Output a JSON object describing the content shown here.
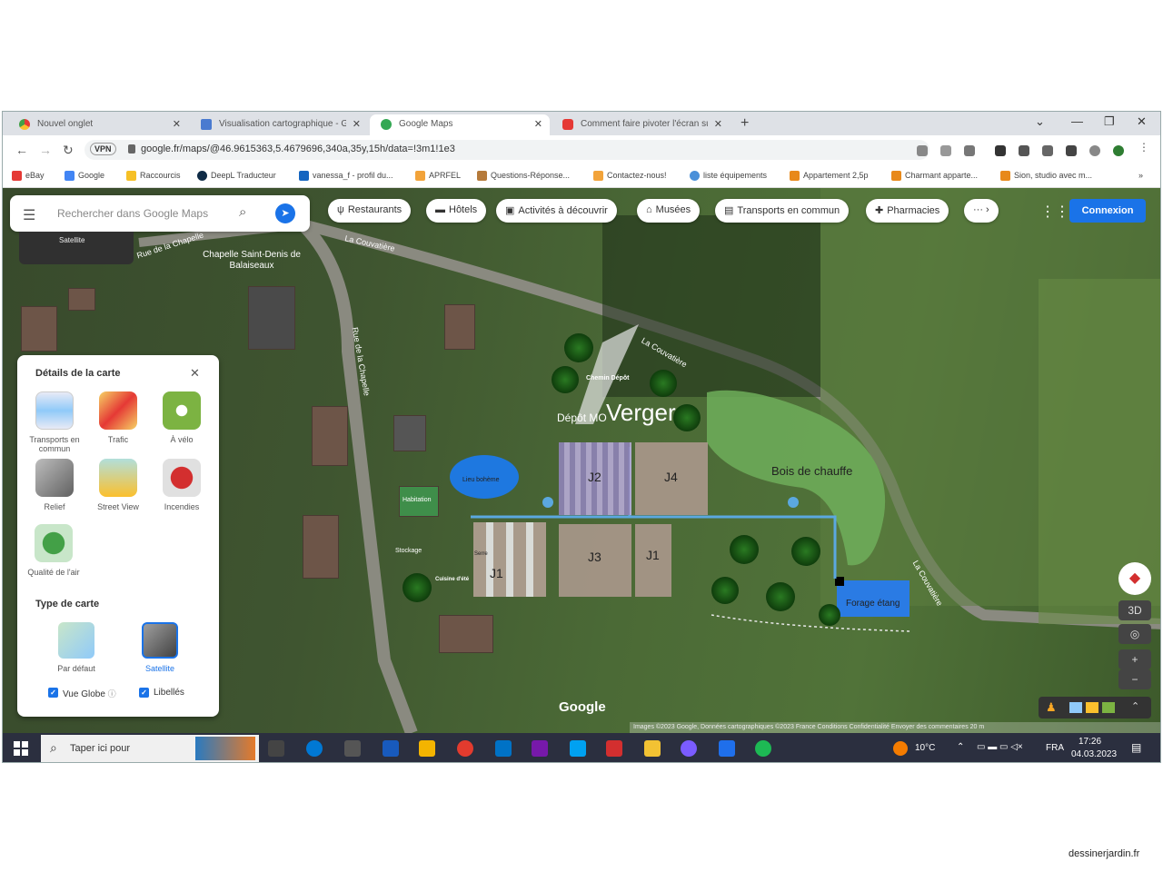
{
  "browser": {
    "tabs": [
      {
        "title": "Nouvel onglet",
        "color": "#f2a33a"
      },
      {
        "title": "Visualisation cartographique - G",
        "color": "#4a7bd0"
      },
      {
        "title": "Google Maps",
        "color": "#34a853"
      },
      {
        "title": "Comment faire pivoter l'écran su",
        "color": "#e53935"
      }
    ],
    "url": "google.fr/maps/@46.9615363,5.4679696,340a,35y,15h/data=!3m1!1e3",
    "vpn_label": "VPN",
    "bookmarks": [
      {
        "label": "eBay",
        "color": "#e53935"
      },
      {
        "label": "Google",
        "color": "#4285f4"
      },
      {
        "label": "Raccourcis",
        "color": "#f6c026"
      },
      {
        "label": "DeepL Traducteur",
        "color": "#0f2b46"
      },
      {
        "label": "vanessa_f - profil du...",
        "color": "#1565c0"
      },
      {
        "label": "APRFEL",
        "color": "#f2a33a"
      },
      {
        "label": "Questions-Réponse...",
        "color": "#b57a3a"
      },
      {
        "label": "Contactez-nous!",
        "color": "#f2a33a"
      },
      {
        "label": "liste équipements",
        "color": "#4a90d9"
      },
      {
        "label": "Appartement 2,5p",
        "color": "#e8891a"
      },
      {
        "label": "Charmant apparte...",
        "color": "#e8891a"
      },
      {
        "label": "Sion, studio avec m...",
        "color": "#e8891a"
      }
    ]
  },
  "maps": {
    "search_placeholder": "Rechercher dans Google Maps",
    "satellite_mini_label": "Satellite",
    "chips": [
      {
        "icon": "ψ",
        "label": "Restaurants"
      },
      {
        "icon": "▬",
        "label": "Hôtels"
      },
      {
        "icon": "▣",
        "label": "Activités à découvrir"
      },
      {
        "icon": "⌂",
        "label": "Musées"
      },
      {
        "icon": "▤",
        "label": "Transports en commun"
      },
      {
        "icon": "✚",
        "label": "Pharmacies"
      },
      {
        "icon": "",
        "label": "··· ›"
      }
    ],
    "login": "Connexion",
    "details": {
      "title": "Détails de la carte",
      "items": [
        {
          "label": "Transports en commun",
          "color": "#e8eaf6"
        },
        {
          "label": "Trafic",
          "color": "#f6d365"
        },
        {
          "label": "À vélo",
          "color": "#7cb342"
        },
        {
          "label": "Relief",
          "color": "#9e9e9e"
        },
        {
          "label": "Street View",
          "color": "#80cbc4"
        },
        {
          "label": "Incendies",
          "color": "#e57373"
        },
        {
          "label": "Qualité de l'air",
          "color": "#81c784"
        }
      ],
      "map_type_title": "Type de carte",
      "map_types": [
        {
          "label": "Par défaut",
          "color": "#a5d6a7"
        },
        {
          "label": "Satellite",
          "color": "#6d6d6d"
        }
      ],
      "checkbox_globe": "Vue Globe",
      "checkbox_labels": "Libellés"
    },
    "overlay_labels": {
      "road1": "Rue de la Chapelle",
      "road2": "Rue de la Chapelle",
      "road3": "La Couvatière",
      "road4": "La Couvatière",
      "road5": "La Couvatière",
      "chapel": "Chapelle Saint-Denis de Balaiseaux",
      "depot": "Dépôt MO",
      "verger": "Verger",
      "chemin": "Chemin Dépôt",
      "bois": "Bois de chauffe",
      "j1a": "J1",
      "j1b": "J1",
      "j2": "J2",
      "j3": "J3",
      "j4": "J4",
      "habitation": "Habitation",
      "stockage": "Stockage",
      "etang": "Forage étang",
      "lieu": "Lieu bohème",
      "serre": "Serre",
      "cuisine": "Cuisine d'été"
    },
    "google_logo": "Google",
    "credit": "Images ©2023 Google, Données cartographiques ©2023   France   Conditions   Confidentialité   Envoyer des commentaires   20 m",
    "controls": {
      "three_d": "3D",
      "zoom_in": "+",
      "zoom_out": "−"
    }
  },
  "taskbar": {
    "search_placeholder": "Taper ici pour",
    "weather": "10°C",
    "lang": "FRA",
    "time": "17:26",
    "date": "04.03.2023",
    "apps": [
      "#444",
      "#0078d4",
      "#2b2b2b",
      "#185abd",
      "#f4b400",
      "#e33b2e",
      "#0072c6",
      "#7719aa",
      "#00a1f1",
      "#d32f2f",
      "#3a7bd5",
      "#7b5cff",
      "#1f6feb",
      "#1db954"
    ]
  },
  "watermark": "dessinerjardin.fr"
}
